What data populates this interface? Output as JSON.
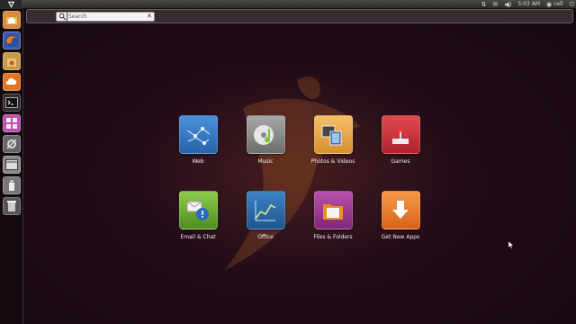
{
  "top_panel": {
    "bfb_icon": "ubuntu-logo-icon",
    "clock": "5:03 AM",
    "user": "cell",
    "indicators": [
      "network-icon",
      "messaging-icon",
      "volume-icon",
      "user-icon",
      "power-icon"
    ]
  },
  "launcher": {
    "items": [
      {
        "name": "home-folder",
        "icon": "home-folder-icon",
        "color": "#d98a3a"
      },
      {
        "name": "firefox",
        "icon": "firefox-icon",
        "color": "#e36b1c"
      },
      {
        "name": "software-center",
        "icon": "shopping-bag-icon",
        "color": "#c79a48"
      },
      {
        "name": "ubuntu-one",
        "icon": "ubuntu-one-icon",
        "color": "#e07526"
      },
      {
        "name": "terminal",
        "icon": "terminal-icon",
        "color": "#2b2b2b"
      },
      {
        "name": "workspaces",
        "icon": "workspaces-icon",
        "color": "#c050b0"
      },
      {
        "name": "system-settings",
        "icon": "settings-icon",
        "color": "#777777"
      },
      {
        "name": "applications",
        "icon": "applications-icon",
        "color": "#8a8a8a"
      },
      {
        "name": "usb-drive",
        "icon": "usb-icon",
        "color": "#aaaaaa"
      },
      {
        "name": "trash",
        "icon": "trash-icon",
        "color": "#999999"
      }
    ]
  },
  "search": {
    "placeholder": "Search"
  },
  "shortcuts": [
    {
      "label": "Web",
      "icon": "globe-icon",
      "color": "#3a7fc8"
    },
    {
      "label": "Music",
      "icon": "music-cd-icon",
      "color": "#8a8a8a"
    },
    {
      "label": "Photos & Videos",
      "icon": "photos-videos-icon",
      "color": "#e8a640"
    },
    {
      "label": "Games",
      "icon": "joystick-icon",
      "color": "#d0323a"
    },
    {
      "label": "Email & Chat",
      "icon": "email-chat-icon",
      "color": "#6aa832"
    },
    {
      "label": "Office",
      "icon": "office-chart-icon",
      "color": "#2e6aa8"
    },
    {
      "label": "Files & Folders",
      "icon": "files-folders-icon",
      "color": "#a43a9a"
    },
    {
      "label": "Get New Apps",
      "icon": "download-arrow-icon",
      "color": "#e8782a"
    }
  ]
}
